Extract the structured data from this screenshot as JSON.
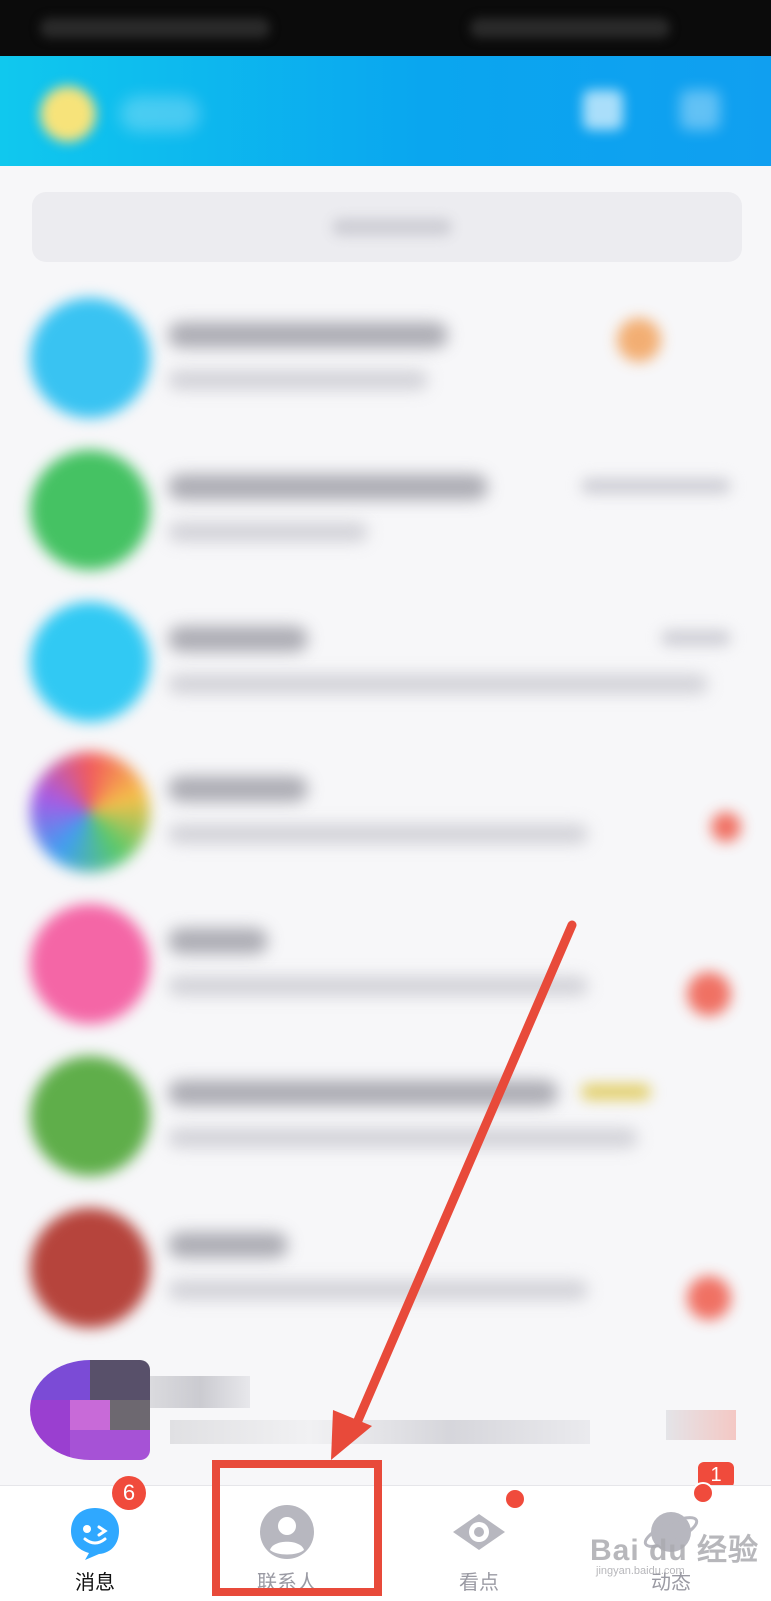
{
  "tabs": [
    {
      "label": "消息",
      "icon": "chat-bubble-face-icon",
      "badge": "6",
      "active": true
    },
    {
      "label": "联系人",
      "icon": "contact-person-icon",
      "highlighted": true
    },
    {
      "label": "看点",
      "icon": "eye-icon",
      "dot": true
    },
    {
      "label": "动态",
      "icon": "planet-icon",
      "dot": true
    }
  ],
  "unread_badge_partial": "1",
  "watermark": {
    "text": "Bai du 经验",
    "sub": "jingyan.baidu.com"
  },
  "colors": {
    "header_gradient_start": "#10c8ee",
    "header_gradient_end": "#109ff0",
    "badge": "#f04b3c",
    "annotation": "#e84a3a",
    "tab_icon_blue": "#2fa8ff",
    "tab_icon_grey": "#b7b7bf"
  }
}
